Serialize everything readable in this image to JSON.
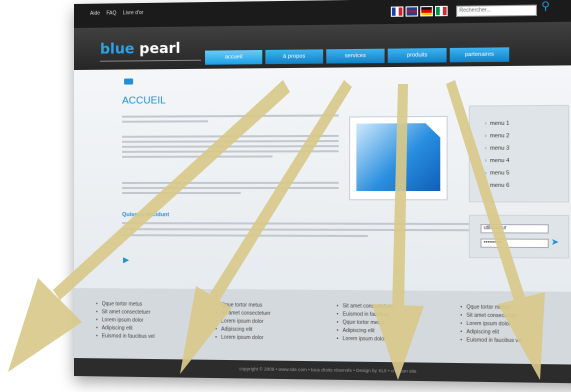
{
  "utility_bar": {
    "links": [
      "Aide",
      "FAQ",
      "Livre d'or"
    ],
    "search_placeholder": "Rechercher...",
    "search_icon": "magnifier-icon",
    "flags": [
      {
        "name": "france-flag-icon",
        "colors": [
          "#1f3fa0",
          "#ffffff",
          "#d0212d"
        ]
      },
      {
        "name": "uk-flag-icon",
        "colors": [
          "#1f3f8f",
          "#ffffff",
          "#c8102e"
        ]
      },
      {
        "name": "germany-flag-icon",
        "colors": [
          "#111111",
          "#dd0000",
          "#ffce00"
        ]
      },
      {
        "name": "italy-flag-icon",
        "colors": [
          "#009246",
          "#ffffff",
          "#ce2b37"
        ]
      }
    ]
  },
  "header": {
    "logo_part1": "blue",
    "logo_part2": "pearl",
    "nav": [
      "accueil",
      "à propos",
      "services",
      "produits",
      "partenaires"
    ],
    "active_nav": "accueil"
  },
  "main": {
    "title": "ACCUEIL",
    "subtitle": "Quisque tincidunt"
  },
  "sidebar": {
    "menu": [
      "menu 1",
      "menu 2",
      "menu 3",
      "menu 4",
      "menu 5",
      "menu 6"
    ],
    "login_user": "utilisateur",
    "login_pass": "••••••••••"
  },
  "footer": {
    "columns": [
      [
        "Qque tortor metus",
        "Sit amet consectetuer",
        "Lorem ipsum dolor",
        "Adipiscing elit",
        "Euismod in faucibus vel"
      ],
      [
        "Qque tortor metus",
        "Sit amet consectetuer",
        "Lorem ipsum dolor",
        "Adipiscing elit",
        "Lorem ipsum dolor"
      ],
      [
        "Sit amet consectetuer",
        "Euismod in faucibus",
        "Qque tortor metus",
        "Adipiscing elit",
        "Lorem ipsum dolor"
      ],
      [
        "Qque tortor metus",
        "Sit amet consectetuer",
        "Lorem ipsum dolor",
        "Adipiscing elit",
        "Euismod in faucibus vel"
      ]
    ],
    "copyright": "copyright © 2009 • www.site.com • tous droits réservés • Design by XLII • création site"
  },
  "colors": {
    "accent": "#1f8fd8",
    "arrow": "#d8c98a"
  }
}
